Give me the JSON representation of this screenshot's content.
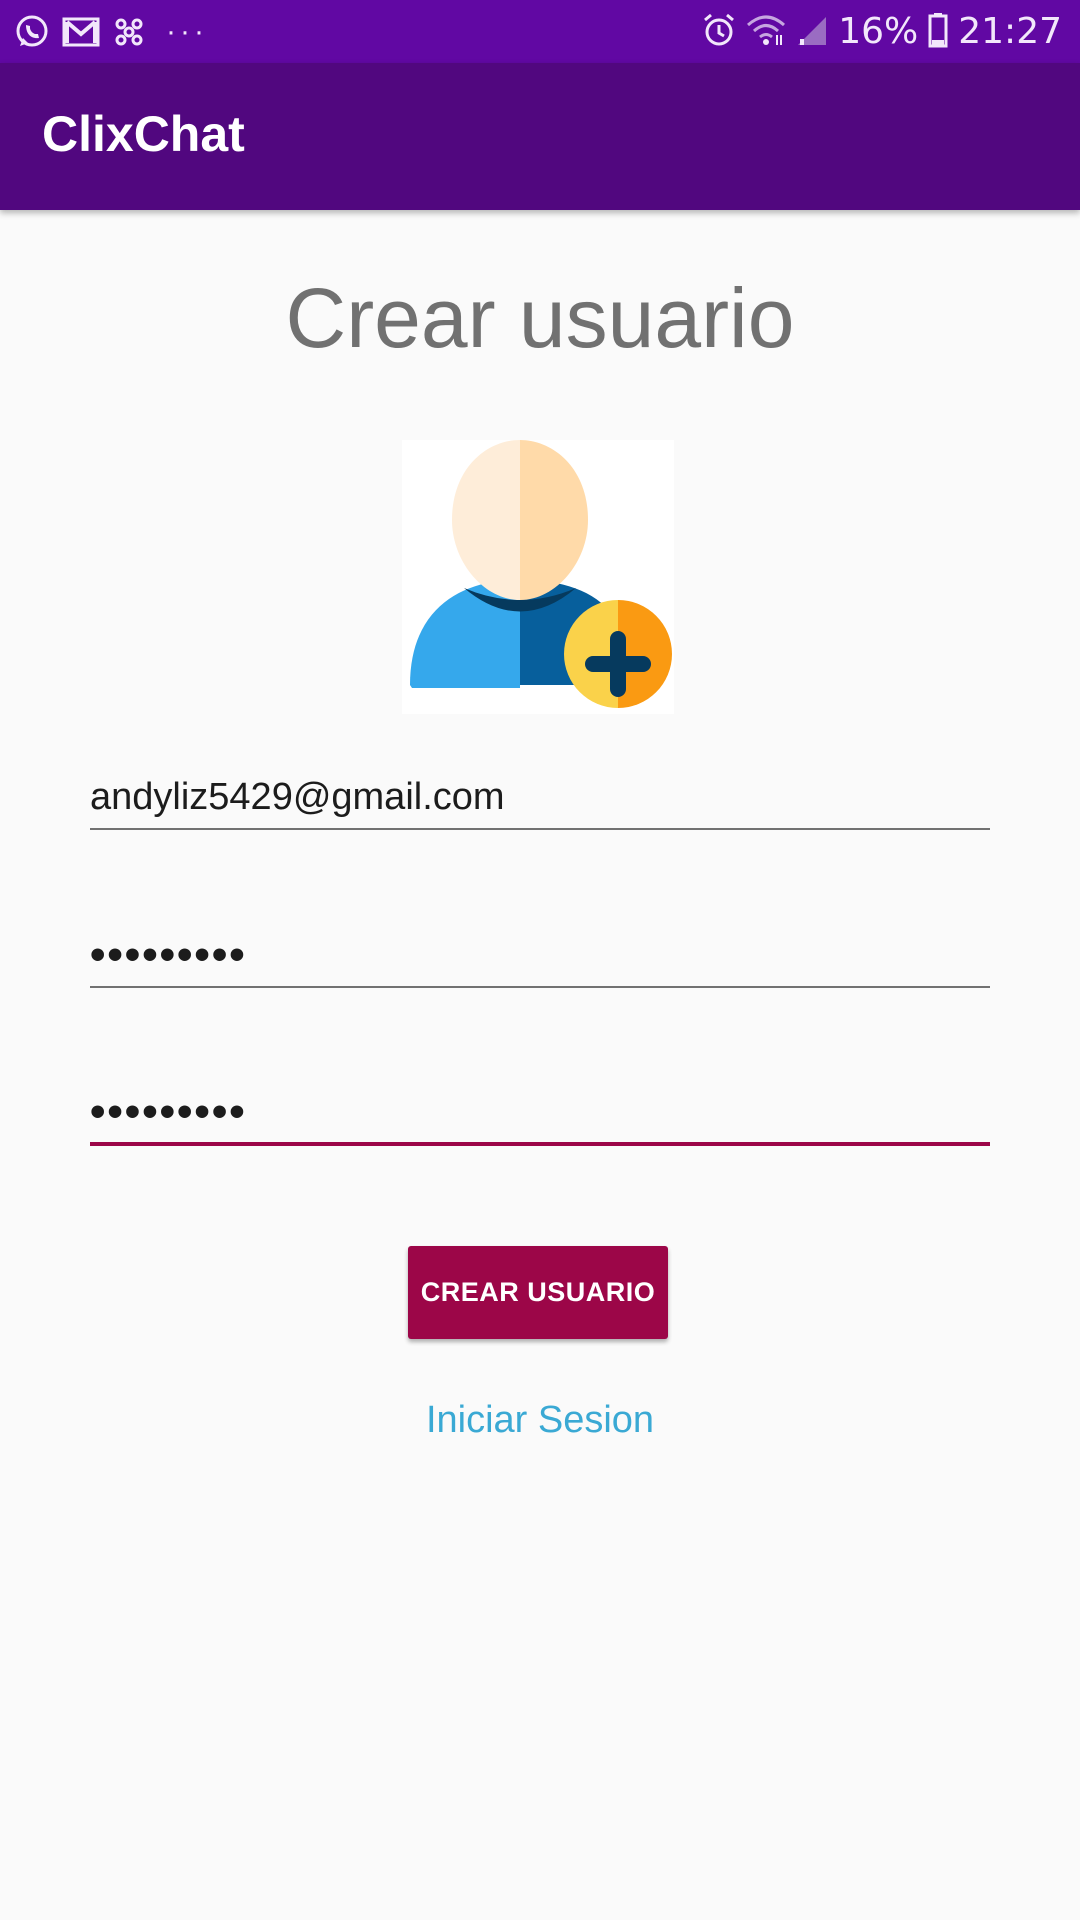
{
  "status_bar": {
    "notification_icons": [
      "whatsapp-icon",
      "gmail-icon",
      "app-flower-icon"
    ],
    "more_indicator": "···",
    "icons_right": [
      "alarm-icon",
      "wifi-icon",
      "signal-icon"
    ],
    "battery_percent": "16%",
    "time": "21:27"
  },
  "app_bar": {
    "title": "ClixChat"
  },
  "screen": {
    "title": "Crear usuario",
    "avatar_icon": "add-user-avatar-icon"
  },
  "form": {
    "email": {
      "value": "andyliz5429@gmail.com",
      "type": "email"
    },
    "password": {
      "value": "•••••••••",
      "type": "password"
    },
    "confirm_password": {
      "value": "•••••••••",
      "type": "password",
      "focused": true
    },
    "submit_label": "CREAR USUARIO",
    "login_link_label": "Iniciar Sesion"
  },
  "colors": {
    "status_bar": "#6108a3",
    "app_bar": "#51077f",
    "accent": "#9c0648",
    "link": "#3aa9d4",
    "background": "#fafafa"
  }
}
